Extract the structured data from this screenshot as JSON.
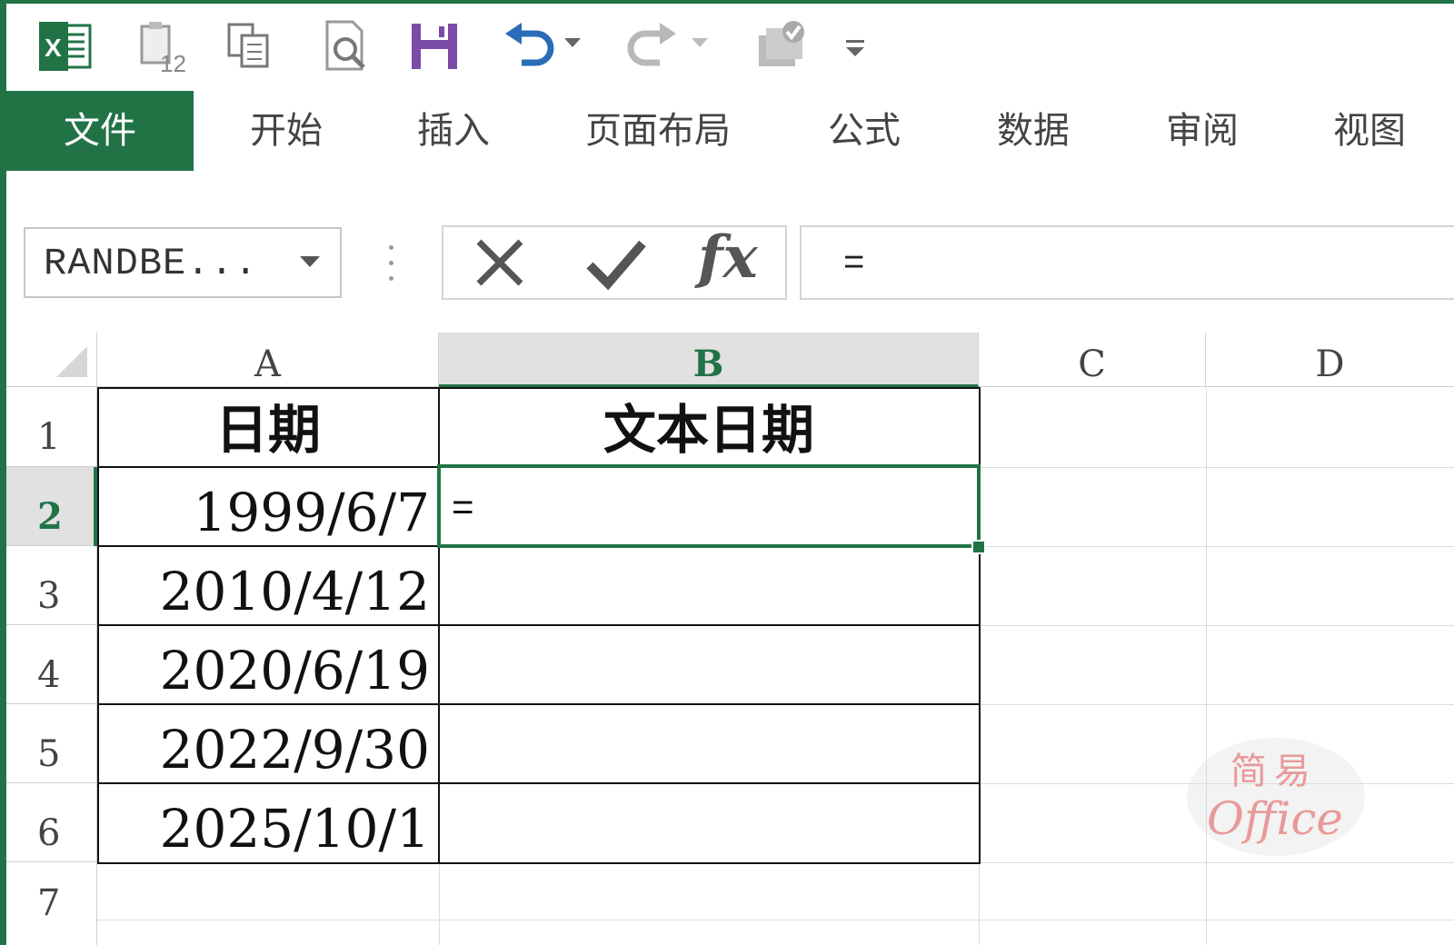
{
  "quick_access": {
    "items": [
      "excel-logo",
      "paste-special",
      "copy",
      "print-preview",
      "save",
      "undo",
      "redo",
      "touch-mode",
      "customize"
    ]
  },
  "ribbon": {
    "tabs": [
      {
        "label": "文件",
        "active": true
      },
      {
        "label": "开始",
        "active": false
      },
      {
        "label": "插入",
        "active": false
      },
      {
        "label": "页面布局",
        "active": false
      },
      {
        "label": "公式",
        "active": false
      },
      {
        "label": "数据",
        "active": false
      },
      {
        "label": "审阅",
        "active": false
      },
      {
        "label": "视图",
        "active": false
      }
    ]
  },
  "formula_bar": {
    "name_box": "RANDBE...",
    "cancel_symbol": "✕",
    "enter_symbol": "✔",
    "fx_label": "fx",
    "content": "="
  },
  "sheet": {
    "columns": [
      "A",
      "B",
      "C",
      "D"
    ],
    "selected_column": "B",
    "rows": [
      "1",
      "2",
      "3",
      "4",
      "5",
      "6",
      "7"
    ],
    "selected_row": "2",
    "header": {
      "a": "日期",
      "b": "文本日期"
    },
    "dates": [
      "1999/6/7",
      "2010/4/12",
      "2020/6/19",
      "2022/9/30",
      "2025/10/1"
    ],
    "editing_cell": "B2",
    "editing_value": "="
  },
  "watermark": {
    "top": "简易",
    "bottom": "Office"
  },
  "colors": {
    "accent": "#217346",
    "header_bg": "#e1e1e1",
    "grid": "#dcdcdc"
  }
}
